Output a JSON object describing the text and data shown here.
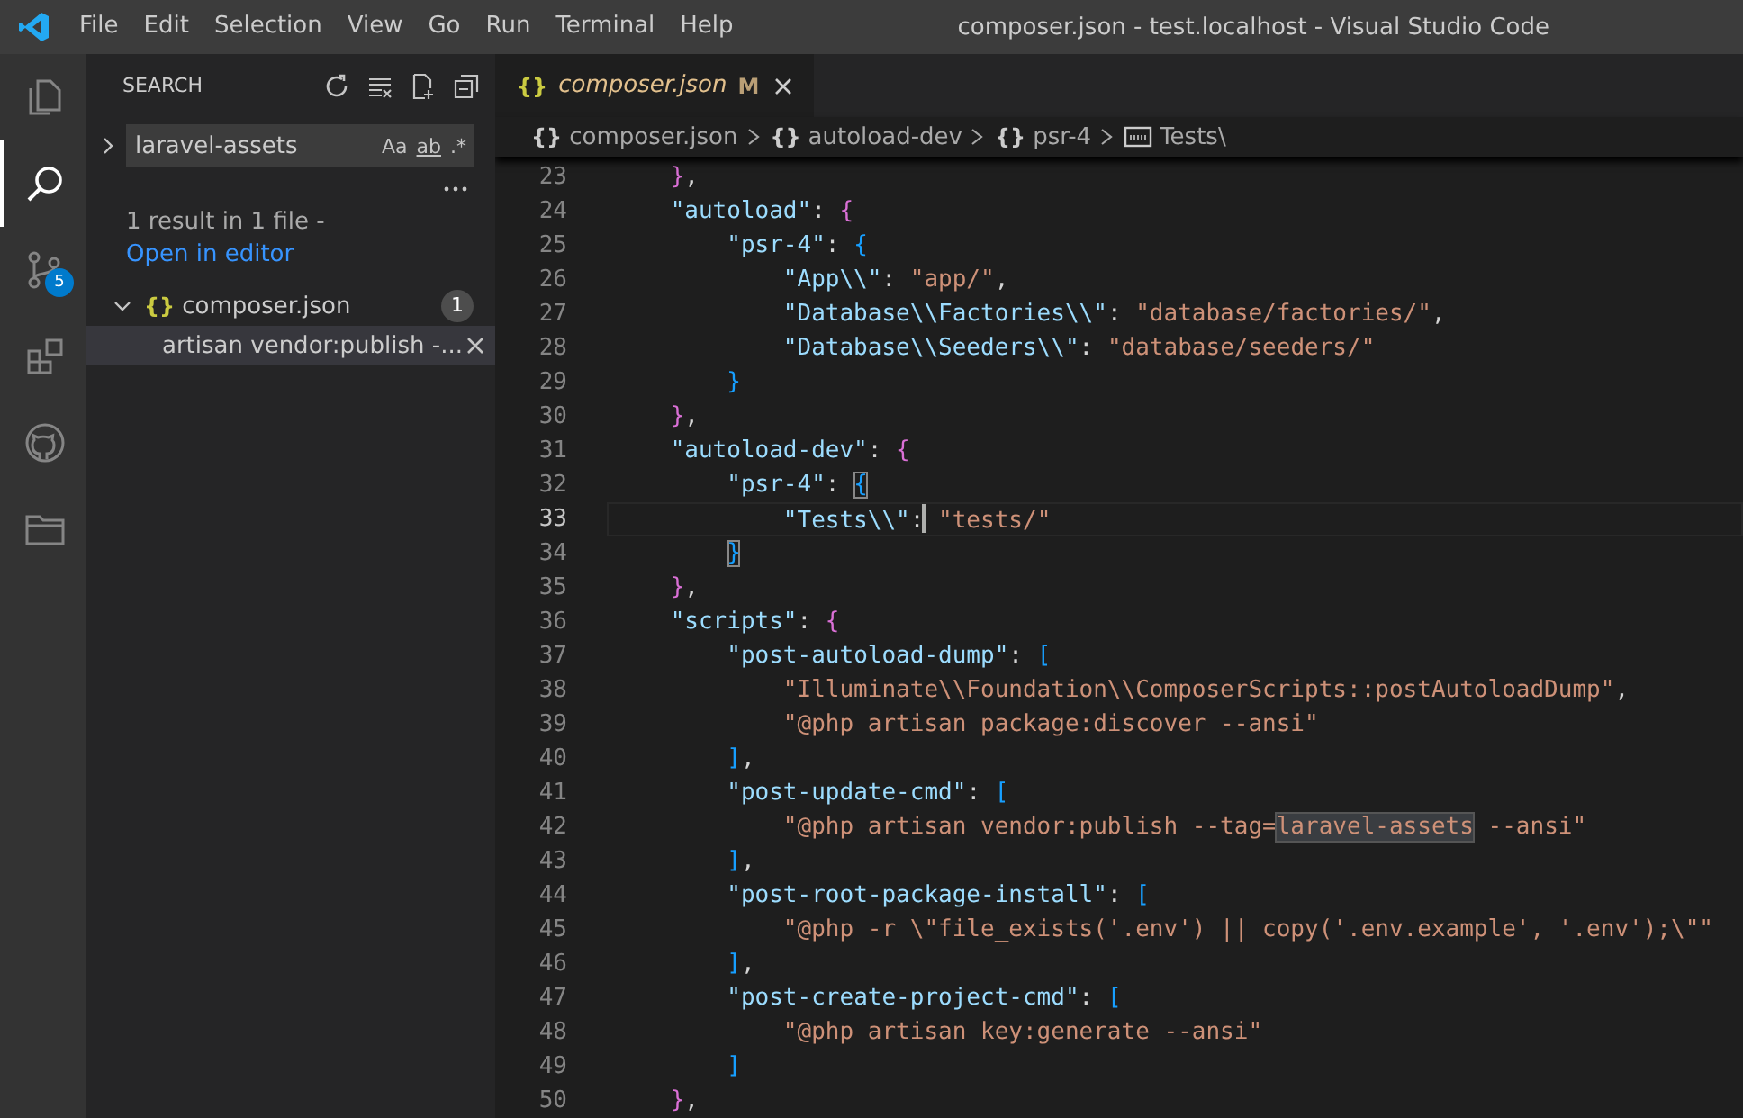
{
  "title_bar": {
    "menu": [
      "File",
      "Edit",
      "Selection",
      "View",
      "Go",
      "Run",
      "Terminal",
      "Help"
    ],
    "title": "composer.json - test.localhost - Visual Studio Code"
  },
  "activity_bar": [
    {
      "kind": "explorer",
      "selected": false
    },
    {
      "kind": "search",
      "selected": true
    },
    {
      "kind": "source-control",
      "selected": false,
      "badge": "5"
    },
    {
      "kind": "extensions",
      "selected": false
    },
    {
      "kind": "github",
      "selected": false
    },
    {
      "kind": "folder",
      "selected": false
    }
  ],
  "sidebar": {
    "title": "SEARCH",
    "search": {
      "value": "laravel-assets",
      "options": [
        "Aa",
        "ab",
        ".*"
      ]
    },
    "summary": "1 result in 1 file - ",
    "summary_link": "Open in editor",
    "results": [
      {
        "icon_text": "{}",
        "file": "composer.json",
        "count": "1",
        "expanded": true,
        "matches": [
          {
            "text": "artisan vendor:publish -...",
            "selected": true
          }
        ]
      }
    ]
  },
  "editor": {
    "tabs": [
      {
        "icon_text": "{}",
        "label": "composer.json",
        "status": "M",
        "selected": true
      }
    ],
    "breadcrumb": [
      {
        "kind": "object",
        "icon_text": "{}",
        "label": "composer.json"
      },
      {
        "kind": "object",
        "icon_text": "{}",
        "label": "autoload-dev"
      },
      {
        "kind": "object",
        "icon_text": "{}",
        "label": "psr-4"
      },
      {
        "kind": "string",
        "label": "Tests\\"
      }
    ],
    "lines": [
      {
        "number": "23",
        "current": false,
        "tokens": [
          {
            "kind": "brace1",
            "text": "}"
          },
          {
            "kind": "punct",
            "text": ","
          }
        ]
      },
      {
        "number": "24",
        "current": false,
        "tokens": [
          {
            "kind": "key",
            "text": "\"autoload\""
          },
          {
            "kind": "punct",
            "text": ": "
          },
          {
            "kind": "brace1",
            "text": "{"
          }
        ]
      },
      {
        "number": "25",
        "current": false,
        "tokens": [
          {
            "kind": "key",
            "text": "\"psr-4\""
          },
          {
            "kind": "punct",
            "text": ": "
          },
          {
            "kind": "brace2",
            "text": "{"
          }
        ]
      },
      {
        "number": "26",
        "current": false,
        "tokens": [
          {
            "kind": "key",
            "text": "\"App\\\\\""
          },
          {
            "kind": "punct",
            "text": ": "
          },
          {
            "kind": "string",
            "text": "\"app/\""
          },
          {
            "kind": "punct",
            "text": ","
          }
        ]
      },
      {
        "number": "27",
        "current": false,
        "tokens": [
          {
            "kind": "key",
            "text": "\"Database\\\\Factories\\\\\""
          },
          {
            "kind": "punct",
            "text": ": "
          },
          {
            "kind": "string",
            "text": "\"database/factories/\""
          },
          {
            "kind": "punct",
            "text": ","
          }
        ]
      },
      {
        "number": "28",
        "current": false,
        "tokens": [
          {
            "kind": "key",
            "text": "\"Database\\\\Seeders\\\\\""
          },
          {
            "kind": "punct",
            "text": ": "
          },
          {
            "kind": "string",
            "text": "\"database/seeders/\""
          }
        ]
      },
      {
        "number": "29",
        "current": false,
        "tokens": [
          {
            "kind": "brace2",
            "text": "}"
          }
        ]
      },
      {
        "number": "30",
        "current": false,
        "tokens": [
          {
            "kind": "brace1",
            "text": "}"
          },
          {
            "kind": "punct",
            "text": ","
          }
        ]
      },
      {
        "number": "31",
        "current": false,
        "tokens": [
          {
            "kind": "key",
            "text": "\"autoload-dev\""
          },
          {
            "kind": "punct",
            "text": ": "
          },
          {
            "kind": "brace1",
            "text": "{"
          }
        ]
      },
      {
        "number": "32",
        "current": false,
        "tokens": [
          {
            "kind": "key",
            "text": "\"psr-4\""
          },
          {
            "kind": "punct",
            "text": ": "
          },
          {
            "kind": "brace-match",
            "text": "{"
          }
        ]
      },
      {
        "number": "33",
        "current": true,
        "tokens": [
          {
            "kind": "key",
            "text": "\"Tests\\\\\""
          },
          {
            "kind": "punct",
            "text": ":"
          },
          {
            "kind": "cursor"
          },
          {
            "kind": "string",
            "text": " \"tests/\""
          }
        ]
      },
      {
        "number": "34",
        "current": false,
        "tokens": [
          {
            "kind": "brace-match",
            "text": "}"
          }
        ]
      },
      {
        "number": "35",
        "current": false,
        "tokens": [
          {
            "kind": "brace1",
            "text": "}"
          },
          {
            "kind": "punct",
            "text": ","
          }
        ]
      },
      {
        "number": "36",
        "current": false,
        "tokens": [
          {
            "kind": "key",
            "text": "\"scripts\""
          },
          {
            "kind": "punct",
            "text": ": "
          },
          {
            "kind": "brace1",
            "text": "{"
          }
        ]
      },
      {
        "number": "37",
        "current": false,
        "tokens": [
          {
            "kind": "key",
            "text": "\"post-autoload-dump\""
          },
          {
            "kind": "punct",
            "text": ": "
          },
          {
            "kind": "brace2",
            "text": "["
          }
        ]
      },
      {
        "number": "38",
        "current": false,
        "tokens": [
          {
            "kind": "string",
            "text": "\"Illuminate\\\\Foundation\\\\ComposerScripts::postAutoloadDump\""
          },
          {
            "kind": "punct",
            "text": ","
          }
        ]
      },
      {
        "number": "39",
        "current": false,
        "tokens": [
          {
            "kind": "string",
            "text": "\"@php artisan package:discover --ansi\""
          }
        ]
      },
      {
        "number": "40",
        "current": false,
        "tokens": [
          {
            "kind": "brace2",
            "text": "]"
          },
          {
            "kind": "punct",
            "text": ","
          }
        ]
      },
      {
        "number": "41",
        "current": false,
        "tokens": [
          {
            "kind": "key",
            "text": "\"post-update-cmd\""
          },
          {
            "kind": "punct",
            "text": ": "
          },
          {
            "kind": "brace2",
            "text": "["
          }
        ]
      },
      {
        "number": "42",
        "current": false,
        "tokens": [
          {
            "kind": "string",
            "text": "\"@php artisan vendor:publish --tag="
          },
          {
            "kind": "match",
            "text": "laravel-assets"
          },
          {
            "kind": "string",
            "text": " --ansi\""
          }
        ]
      },
      {
        "number": "43",
        "current": false,
        "tokens": [
          {
            "kind": "brace2",
            "text": "]"
          },
          {
            "kind": "punct",
            "text": ","
          }
        ]
      },
      {
        "number": "44",
        "current": false,
        "tokens": [
          {
            "kind": "key",
            "text": "\"post-root-package-install\""
          },
          {
            "kind": "punct",
            "text": ": "
          },
          {
            "kind": "brace2",
            "text": "["
          }
        ]
      },
      {
        "number": "45",
        "current": false,
        "tokens": [
          {
            "kind": "string",
            "text": "\"@php -r \\\"file_exists('.env') || copy('.env.example', '.env');\\\"\""
          }
        ]
      },
      {
        "number": "46",
        "current": false,
        "tokens": [
          {
            "kind": "brace2",
            "text": "]"
          },
          {
            "kind": "punct",
            "text": ","
          }
        ]
      },
      {
        "number": "47",
        "current": false,
        "tokens": [
          {
            "kind": "key",
            "text": "\"post-create-project-cmd\""
          },
          {
            "kind": "punct",
            "text": ": "
          },
          {
            "kind": "brace2",
            "text": "["
          }
        ]
      },
      {
        "number": "48",
        "current": false,
        "tokens": [
          {
            "kind": "string",
            "text": "\"@php artisan key:generate --ansi\""
          }
        ]
      },
      {
        "number": "49",
        "current": false,
        "tokens": [
          {
            "kind": "brace2",
            "text": "]"
          }
        ]
      },
      {
        "number": "50",
        "current": false,
        "tokens": [
          {
            "kind": "brace1",
            "text": "}"
          },
          {
            "kind": "punct",
            "text": ","
          }
        ]
      }
    ]
  }
}
